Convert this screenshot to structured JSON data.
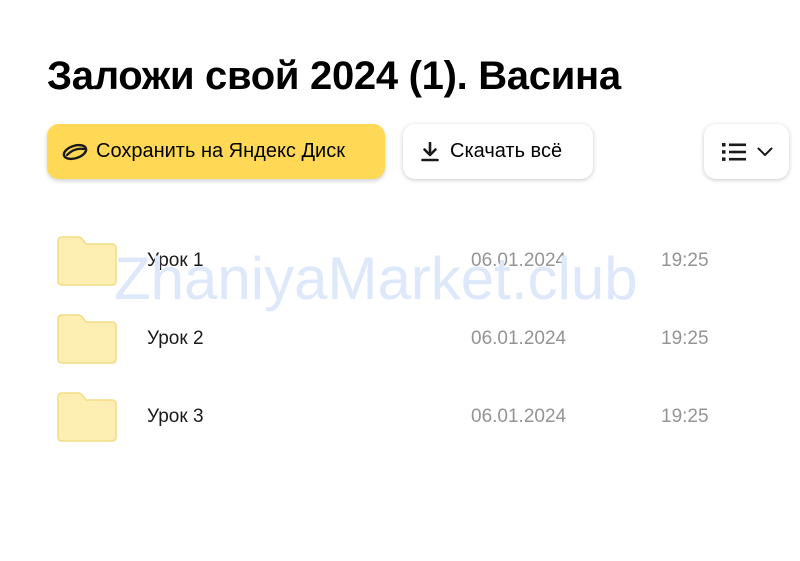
{
  "header": {
    "title": "Заложи свой 2024 (1). Васина"
  },
  "toolbar": {
    "save_label": "Сохранить на Яндекс Диск",
    "download_label": "Скачать всё",
    "save_icon": "yandex-disk-icon",
    "download_icon": "download-icon",
    "view_icon": "list-view-icon"
  },
  "watermark": "ZhaniyaMarket.club",
  "files": [
    {
      "name": "Урок 1",
      "date": "06.01.2024",
      "time": "19:25",
      "icon": "folder-icon"
    },
    {
      "name": "Урок 2",
      "date": "06.01.2024",
      "time": "19:25",
      "icon": "folder-icon"
    },
    {
      "name": "Урок 3",
      "date": "06.01.2024",
      "time": "19:25",
      "icon": "folder-icon"
    }
  ],
  "colors": {
    "accent": "#ffd955",
    "folder_fill": "#fdefb2",
    "folder_stroke": "#f3dc86",
    "muted_text": "#949494",
    "watermark": "#dde8fb"
  }
}
